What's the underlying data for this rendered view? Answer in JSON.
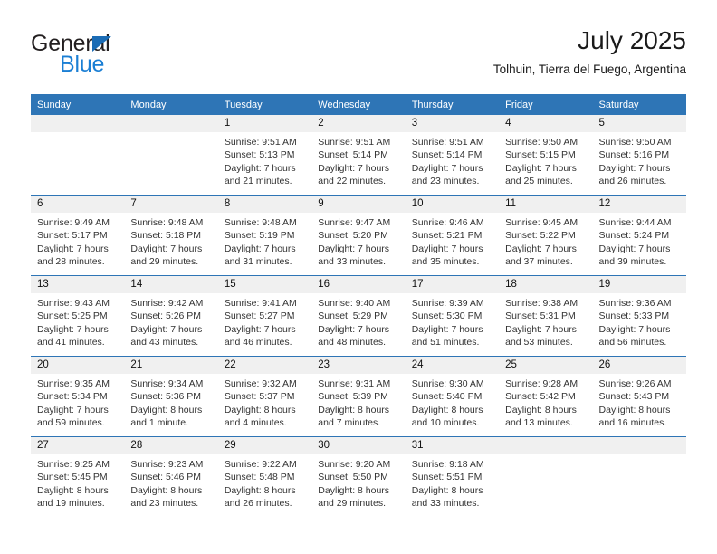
{
  "brand": {
    "name_part1": "General",
    "name_part2": "Blue",
    "triangle_icon": "triangle-icon",
    "color_dark": "#231f20",
    "color_blue": "#1b7fd4"
  },
  "header": {
    "title": "July 2025",
    "subtitle": "Tolhuin, Tierra del Fuego, Argentina"
  },
  "calendar": {
    "accent_color": "#2e75b6",
    "daynum_band_color": "#f0f0f0",
    "weekday_headers": [
      "Sunday",
      "Monday",
      "Tuesday",
      "Wednesday",
      "Thursday",
      "Friday",
      "Saturday"
    ],
    "weeks": [
      [
        {
          "day": "",
          "sunrise": "",
          "sunset": "",
          "daylight_line1": "",
          "daylight_line2": ""
        },
        {
          "day": "",
          "sunrise": "",
          "sunset": "",
          "daylight_line1": "",
          "daylight_line2": ""
        },
        {
          "day": "1",
          "sunrise": "Sunrise: 9:51 AM",
          "sunset": "Sunset: 5:13 PM",
          "daylight_line1": "Daylight: 7 hours",
          "daylight_line2": "and 21 minutes."
        },
        {
          "day": "2",
          "sunrise": "Sunrise: 9:51 AM",
          "sunset": "Sunset: 5:14 PM",
          "daylight_line1": "Daylight: 7 hours",
          "daylight_line2": "and 22 minutes."
        },
        {
          "day": "3",
          "sunrise": "Sunrise: 9:51 AM",
          "sunset": "Sunset: 5:14 PM",
          "daylight_line1": "Daylight: 7 hours",
          "daylight_line2": "and 23 minutes."
        },
        {
          "day": "4",
          "sunrise": "Sunrise: 9:50 AM",
          "sunset": "Sunset: 5:15 PM",
          "daylight_line1": "Daylight: 7 hours",
          "daylight_line2": "and 25 minutes."
        },
        {
          "day": "5",
          "sunrise": "Sunrise: 9:50 AM",
          "sunset": "Sunset: 5:16 PM",
          "daylight_line1": "Daylight: 7 hours",
          "daylight_line2": "and 26 minutes."
        }
      ],
      [
        {
          "day": "6",
          "sunrise": "Sunrise: 9:49 AM",
          "sunset": "Sunset: 5:17 PM",
          "daylight_line1": "Daylight: 7 hours",
          "daylight_line2": "and 28 minutes."
        },
        {
          "day": "7",
          "sunrise": "Sunrise: 9:48 AM",
          "sunset": "Sunset: 5:18 PM",
          "daylight_line1": "Daylight: 7 hours",
          "daylight_line2": "and 29 minutes."
        },
        {
          "day": "8",
          "sunrise": "Sunrise: 9:48 AM",
          "sunset": "Sunset: 5:19 PM",
          "daylight_line1": "Daylight: 7 hours",
          "daylight_line2": "and 31 minutes."
        },
        {
          "day": "9",
          "sunrise": "Sunrise: 9:47 AM",
          "sunset": "Sunset: 5:20 PM",
          "daylight_line1": "Daylight: 7 hours",
          "daylight_line2": "and 33 minutes."
        },
        {
          "day": "10",
          "sunrise": "Sunrise: 9:46 AM",
          "sunset": "Sunset: 5:21 PM",
          "daylight_line1": "Daylight: 7 hours",
          "daylight_line2": "and 35 minutes."
        },
        {
          "day": "11",
          "sunrise": "Sunrise: 9:45 AM",
          "sunset": "Sunset: 5:22 PM",
          "daylight_line1": "Daylight: 7 hours",
          "daylight_line2": "and 37 minutes."
        },
        {
          "day": "12",
          "sunrise": "Sunrise: 9:44 AM",
          "sunset": "Sunset: 5:24 PM",
          "daylight_line1": "Daylight: 7 hours",
          "daylight_line2": "and 39 minutes."
        }
      ],
      [
        {
          "day": "13",
          "sunrise": "Sunrise: 9:43 AM",
          "sunset": "Sunset: 5:25 PM",
          "daylight_line1": "Daylight: 7 hours",
          "daylight_line2": "and 41 minutes."
        },
        {
          "day": "14",
          "sunrise": "Sunrise: 9:42 AM",
          "sunset": "Sunset: 5:26 PM",
          "daylight_line1": "Daylight: 7 hours",
          "daylight_line2": "and 43 minutes."
        },
        {
          "day": "15",
          "sunrise": "Sunrise: 9:41 AM",
          "sunset": "Sunset: 5:27 PM",
          "daylight_line1": "Daylight: 7 hours",
          "daylight_line2": "and 46 minutes."
        },
        {
          "day": "16",
          "sunrise": "Sunrise: 9:40 AM",
          "sunset": "Sunset: 5:29 PM",
          "daylight_line1": "Daylight: 7 hours",
          "daylight_line2": "and 48 minutes."
        },
        {
          "day": "17",
          "sunrise": "Sunrise: 9:39 AM",
          "sunset": "Sunset: 5:30 PM",
          "daylight_line1": "Daylight: 7 hours",
          "daylight_line2": "and 51 minutes."
        },
        {
          "day": "18",
          "sunrise": "Sunrise: 9:38 AM",
          "sunset": "Sunset: 5:31 PM",
          "daylight_line1": "Daylight: 7 hours",
          "daylight_line2": "and 53 minutes."
        },
        {
          "day": "19",
          "sunrise": "Sunrise: 9:36 AM",
          "sunset": "Sunset: 5:33 PM",
          "daylight_line1": "Daylight: 7 hours",
          "daylight_line2": "and 56 minutes."
        }
      ],
      [
        {
          "day": "20",
          "sunrise": "Sunrise: 9:35 AM",
          "sunset": "Sunset: 5:34 PM",
          "daylight_line1": "Daylight: 7 hours",
          "daylight_line2": "and 59 minutes."
        },
        {
          "day": "21",
          "sunrise": "Sunrise: 9:34 AM",
          "sunset": "Sunset: 5:36 PM",
          "daylight_line1": "Daylight: 8 hours",
          "daylight_line2": "and 1 minute."
        },
        {
          "day": "22",
          "sunrise": "Sunrise: 9:32 AM",
          "sunset": "Sunset: 5:37 PM",
          "daylight_line1": "Daylight: 8 hours",
          "daylight_line2": "and 4 minutes."
        },
        {
          "day": "23",
          "sunrise": "Sunrise: 9:31 AM",
          "sunset": "Sunset: 5:39 PM",
          "daylight_line1": "Daylight: 8 hours",
          "daylight_line2": "and 7 minutes."
        },
        {
          "day": "24",
          "sunrise": "Sunrise: 9:30 AM",
          "sunset": "Sunset: 5:40 PM",
          "daylight_line1": "Daylight: 8 hours",
          "daylight_line2": "and 10 minutes."
        },
        {
          "day": "25",
          "sunrise": "Sunrise: 9:28 AM",
          "sunset": "Sunset: 5:42 PM",
          "daylight_line1": "Daylight: 8 hours",
          "daylight_line2": "and 13 minutes."
        },
        {
          "day": "26",
          "sunrise": "Sunrise: 9:26 AM",
          "sunset": "Sunset: 5:43 PM",
          "daylight_line1": "Daylight: 8 hours",
          "daylight_line2": "and 16 minutes."
        }
      ],
      [
        {
          "day": "27",
          "sunrise": "Sunrise: 9:25 AM",
          "sunset": "Sunset: 5:45 PM",
          "daylight_line1": "Daylight: 8 hours",
          "daylight_line2": "and 19 minutes."
        },
        {
          "day": "28",
          "sunrise": "Sunrise: 9:23 AM",
          "sunset": "Sunset: 5:46 PM",
          "daylight_line1": "Daylight: 8 hours",
          "daylight_line2": "and 23 minutes."
        },
        {
          "day": "29",
          "sunrise": "Sunrise: 9:22 AM",
          "sunset": "Sunset: 5:48 PM",
          "daylight_line1": "Daylight: 8 hours",
          "daylight_line2": "and 26 minutes."
        },
        {
          "day": "30",
          "sunrise": "Sunrise: 9:20 AM",
          "sunset": "Sunset: 5:50 PM",
          "daylight_line1": "Daylight: 8 hours",
          "daylight_line2": "and 29 minutes."
        },
        {
          "day": "31",
          "sunrise": "Sunrise: 9:18 AM",
          "sunset": "Sunset: 5:51 PM",
          "daylight_line1": "Daylight: 8 hours",
          "daylight_line2": "and 33 minutes."
        },
        {
          "day": "",
          "sunrise": "",
          "sunset": "",
          "daylight_line1": "",
          "daylight_line2": ""
        },
        {
          "day": "",
          "sunrise": "",
          "sunset": "",
          "daylight_line1": "",
          "daylight_line2": ""
        }
      ]
    ]
  }
}
